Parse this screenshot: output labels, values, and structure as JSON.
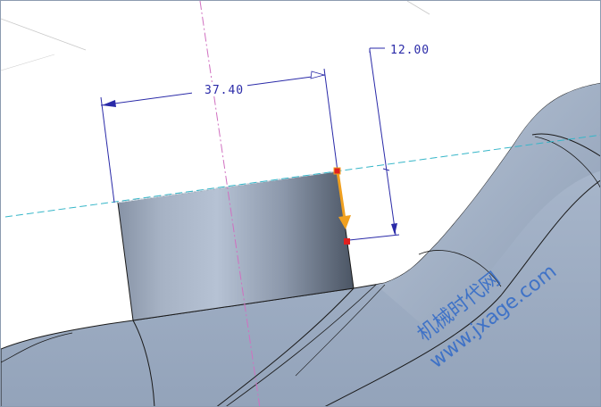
{
  "dimensions": {
    "width_label": "37.40",
    "height_label": "12.00"
  },
  "watermark": {
    "line1": "机械时代网",
    "line2": "www.jxage.com"
  },
  "colors": {
    "dimension": "#2a2aa8",
    "sketch_plane": "#36b6c8",
    "axis": "#d070c0",
    "drag_arrow": "#f0a020",
    "drag_handle": "#e02020",
    "surface": "#a3b2c6",
    "edge": "#1a1a1a"
  }
}
